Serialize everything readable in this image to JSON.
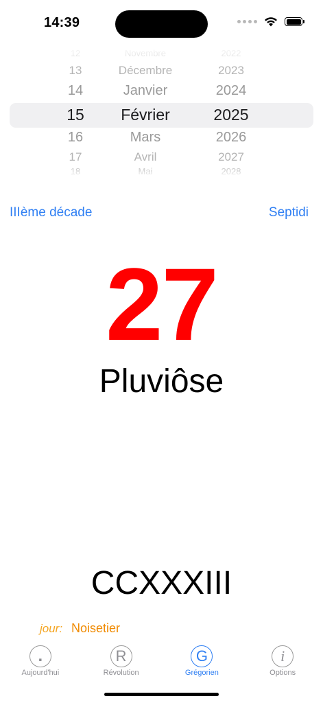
{
  "status_bar": {
    "time": "14:39"
  },
  "picker": {
    "rows": [
      {
        "day": "12",
        "month": "Novembre",
        "year": "2022"
      },
      {
        "day": "13",
        "month": "Décembre",
        "year": "2023"
      },
      {
        "day": "14",
        "month": "Janvier",
        "year": "2024"
      },
      {
        "day": "15",
        "month": "Février",
        "year": "2025"
      },
      {
        "day": "16",
        "month": "Mars",
        "year": "2026"
      },
      {
        "day": "17",
        "month": "Avril",
        "year": "2027"
      },
      {
        "day": "18",
        "month": "Mai",
        "year": "2028"
      }
    ],
    "selected": {
      "day": "15",
      "month": "Février",
      "year": "2025"
    }
  },
  "republican": {
    "decade": "IIIème décade",
    "weekday": "Septidi",
    "day_number": "27",
    "month_name": "Pluviôse",
    "year_roman": "CCXXXIII",
    "jour_label": "jour:",
    "jour_value": "Noisetier"
  },
  "colors": {
    "accent_blue": "#2f7ff3",
    "day_red": "#ff0000",
    "jour_orange": "#f08a00"
  },
  "tabbar": {
    "tabs": [
      {
        "icon": "dot-circle-icon",
        "glyph": ".",
        "label": "Aujourd'hui",
        "active": false
      },
      {
        "icon": "r-circle-icon",
        "glyph": "R",
        "label": "Révolution",
        "active": false
      },
      {
        "icon": "g-circle-icon",
        "glyph": "G",
        "label": "Grégorien",
        "active": true
      },
      {
        "icon": "info-circle-icon",
        "glyph": "i",
        "label": "Options",
        "active": false
      }
    ]
  }
}
